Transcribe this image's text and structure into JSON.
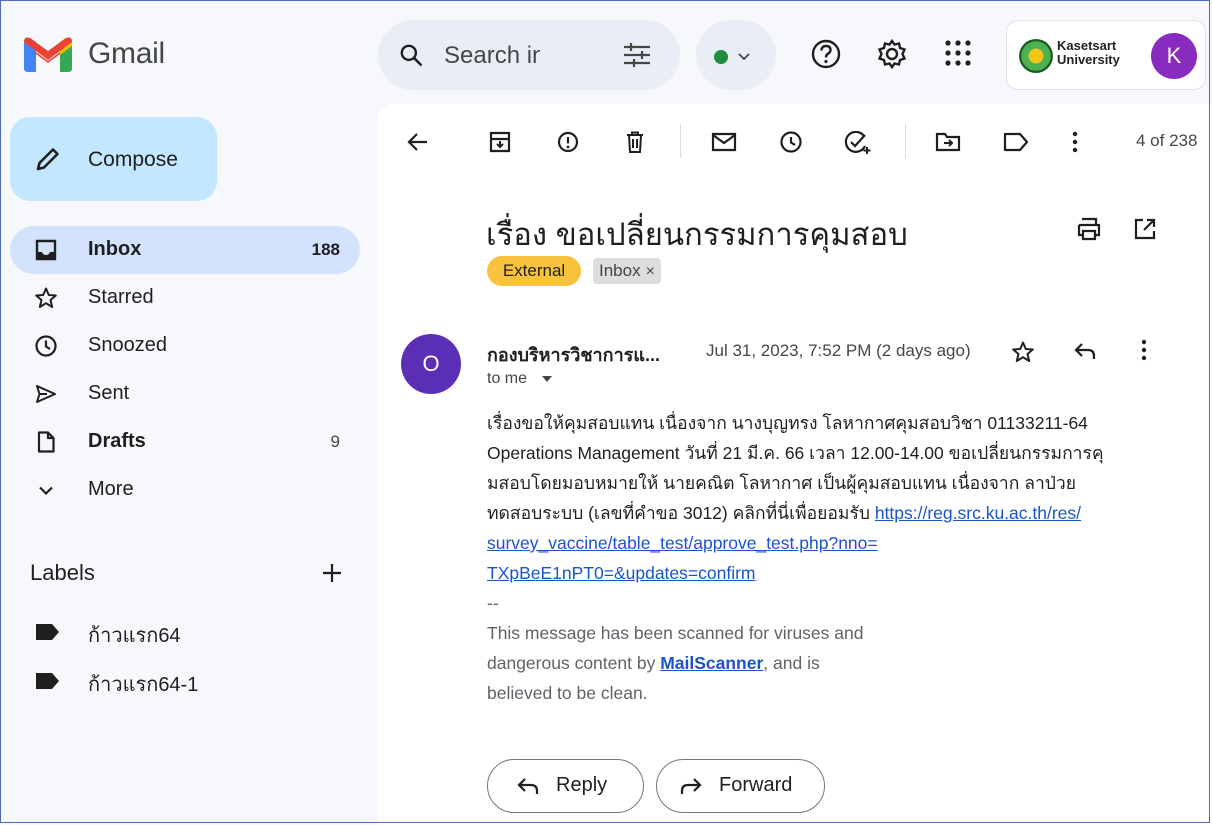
{
  "app": {
    "name": "Gmail"
  },
  "search": {
    "placeholder": "Search in mail"
  },
  "account": {
    "org_line1": "Kasetsart",
    "org_line2": "University",
    "avatar_letter": "K"
  },
  "compose": {
    "label": "Compose"
  },
  "nav": [
    {
      "label": "Inbox",
      "count": "188",
      "icon": "inbox-icon"
    },
    {
      "label": "Starred",
      "count": "",
      "icon": "star-icon"
    },
    {
      "label": "Snoozed",
      "count": "",
      "icon": "clock-icon"
    },
    {
      "label": "Sent",
      "count": "",
      "icon": "send-icon"
    },
    {
      "label": "Drafts",
      "count": "9",
      "icon": "draft-icon"
    },
    {
      "label": "More",
      "count": "",
      "icon": "chevron-down-icon"
    }
  ],
  "labels": {
    "heading": "Labels",
    "items": [
      "ก้าวแรก64",
      "ก้าวแรก64-1"
    ]
  },
  "toolbar": {
    "pager": "4 of 238"
  },
  "message": {
    "subject": "เรื่อง ขอเปลี่ยนกรรมการคุมสอบ",
    "chip_external": "External",
    "chip_inbox": "Inbox",
    "sender_initial": "O",
    "sender_name": "กองบริหารวิชาการแ...",
    "date": "Jul 31, 2023, 7:52 PM (2 days ago)",
    "to": "to me",
    "body_line1": "เรื่องขอให้คุมสอบแทน เนื่องจาก นางบุญทรง โลหากาศคุมสอบวิชา 01133211-64",
    "body_line2": "Operations Management วันที่ 21 มี.ค. 66 เวลา 12.00-14.00 ขอเปลี่ยนกรรมการคุ",
    "body_line3": "มสอบโดยมอบหมายให้ นายคณิต โลหากาศ เป็นผู้คุมสอบแทน เนื่องจาก ลาป่วย",
    "body_line4_prefix": "ทดสอบระบบ (เลขที่คำขอ 3012) คลิกที่นี่เพื่อยอมรับ ",
    "link_part1": "https://reg.src.ku.ac.th/res/",
    "link_part2": "survey_vaccine/table_test/approve_test.php?nno=",
    "link_part3": "TXpBeE1nPT0=&updates=confirm",
    "sig_dashes": "--",
    "sig_line1": "This message has been scanned for viruses and",
    "sig_line2_prefix": "dangerous content by ",
    "sig_mailscanner": "MailScanner",
    "sig_line2_suffix": ", and is",
    "sig_line3": "believed to be clean."
  },
  "actions": {
    "reply": "Reply",
    "forward": "Forward"
  }
}
